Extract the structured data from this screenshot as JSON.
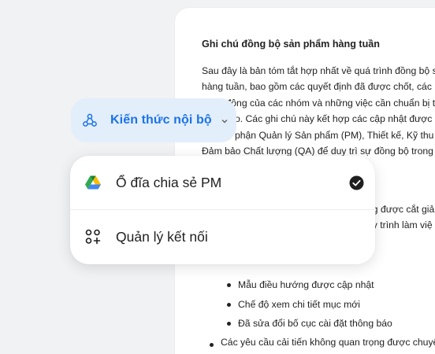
{
  "document": {
    "title": "Ghi chú đồng bộ sản phẩm hàng tuần",
    "paragraph_lines": [
      "Sau đây là bản tóm tắt hợp nhất về quá trình đồng bộ sản",
      "hàng tuần, bao gồm các quyết định đã được chốt, các hạn",
      "hành động của các nhóm và những việc cần chuẩn bị trước",
      "theo. Các ghi chú này kết hợp các cập nhật được",
      "bộ phận Quản lý Sản phẩm (PM), Thiết kế, Kỹ thu",
      "Đảm bảo Chất lượng (QA) để duy trì sự đồng bộ trong suố"
    ],
    "partial_line_1": "ng được cắt giả",
    "partial_line_2": "uy trình làm việ",
    "sub_bullets": [
      "Mẫu điều hướng được cập nhật",
      "Chế độ xem chi tiết mục mới",
      "Đã sửa đổi bố cục cài đặt thông báo"
    ],
    "main_bullet": "Các yêu cầu cải tiến không quan trọng được chuyển s"
  },
  "knowledge_chip": {
    "label": "Kiến thức nội bộ",
    "icon": "knowledge-nodes-icon",
    "caret_icon": "chevron-down-icon"
  },
  "source_menu": {
    "items": [
      {
        "label": "Ổ đĩa chia sẻ PM",
        "icon": "google-drive-icon",
        "selected": true
      },
      {
        "label": "Quản lý kết nối",
        "icon": "manage-connections-icon",
        "selected": false
      }
    ]
  },
  "colors": {
    "accent": "#1a73e8",
    "chip_bg": "#e3eefb",
    "page_bg": "#f1f2f4"
  }
}
